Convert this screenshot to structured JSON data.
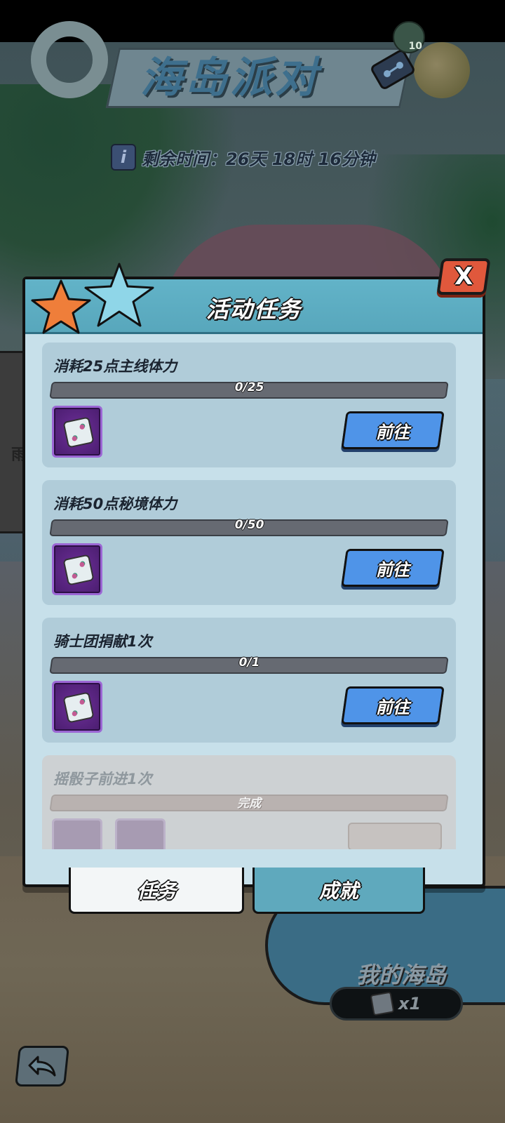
{
  "event": {
    "title": "海岛派对",
    "time_label": "剩余时间：26天 18时 16分钟",
    "map_badge": "10"
  },
  "modal": {
    "title": "活动任务",
    "close_label": "X",
    "tasks": [
      {
        "title": "消耗25点主线体力",
        "progress_text": "0/25",
        "progress": 0,
        "action_label": "前往",
        "status": "active"
      },
      {
        "title": "消耗50点秘境体力",
        "progress_text": "0/50",
        "progress": 0,
        "action_label": "前往",
        "status": "active"
      },
      {
        "title": "骑士团捐献1次",
        "progress_text": "0/1",
        "progress": 0,
        "action_label": "前往",
        "status": "active"
      },
      {
        "title": "摇骰子前进1次",
        "progress_text": "完成",
        "progress": 1,
        "action_label": "",
        "status": "done"
      }
    ],
    "tabs": [
      {
        "label": "任务",
        "active": true
      },
      {
        "label": "成就",
        "active": false
      }
    ]
  },
  "island": {
    "label": "我的海岛",
    "dice_count": "x1"
  },
  "left_sign": {
    "text": "雨"
  },
  "icons": {
    "reward": "dice-icon",
    "back": "back-arrow-icon",
    "close": "close-icon",
    "info": "info-icon"
  },
  "colors": {
    "go_button": "#4f94e8",
    "close_button": "#e0583c",
    "modal_header": "#62b3c8",
    "card": "#b0ccd9"
  }
}
